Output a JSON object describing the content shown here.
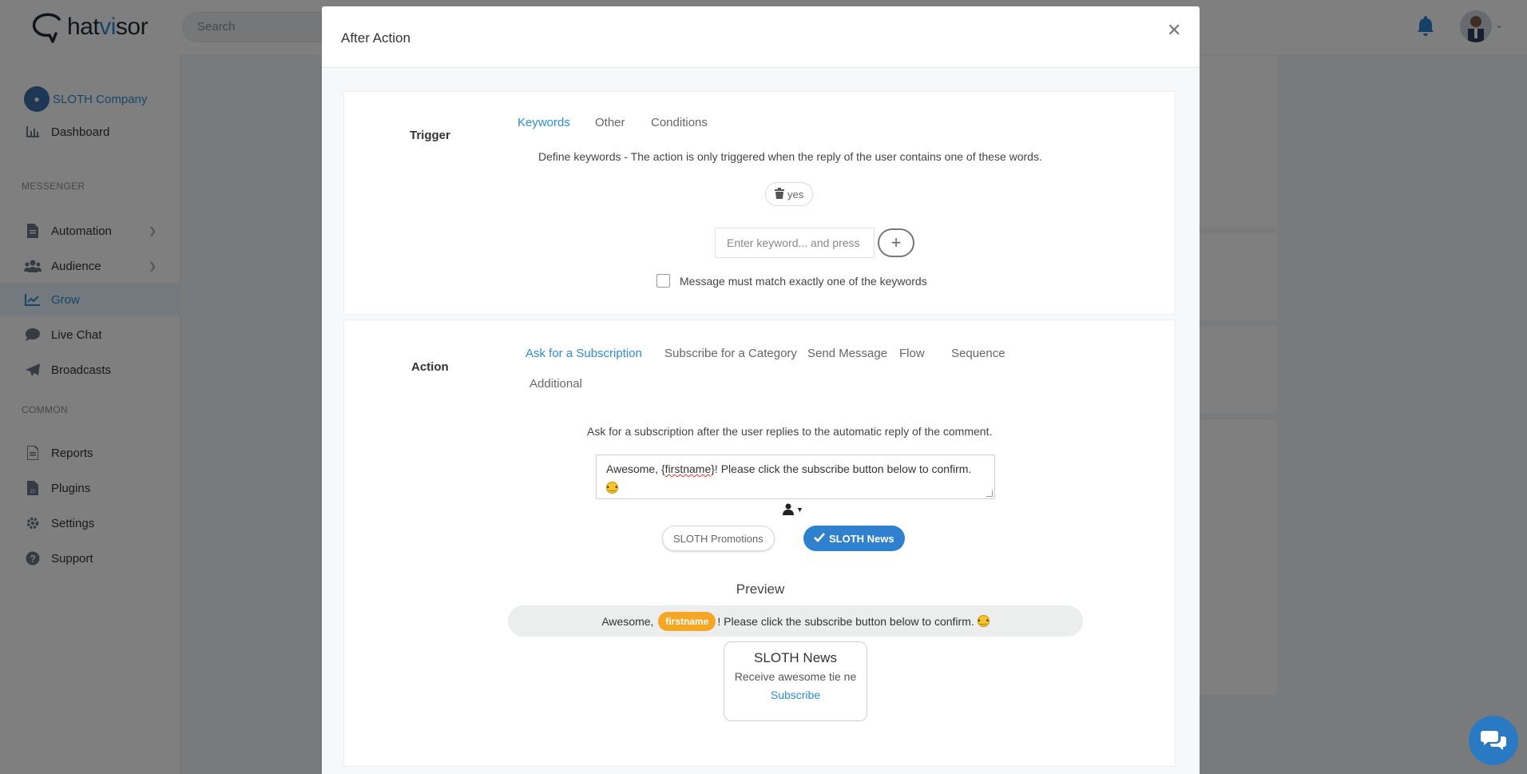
{
  "app": {
    "logo_prefix": "hat",
    "logo_accent": "vi",
    "logo_suffix": "sor",
    "search_placeholder": "Search",
    "accent_color": "#2d8bd6"
  },
  "sidebar": {
    "company": "SLOTH Company",
    "items": [
      {
        "label": "Dashboard",
        "icon": "chart-bar-icon"
      },
      {
        "label": "Automation",
        "icon": "document-icon"
      },
      {
        "label": "Audience",
        "icon": "users-icon"
      },
      {
        "label": "Grow",
        "icon": "line-chart-icon"
      },
      {
        "label": "Live Chat",
        "icon": "chat-bubble-icon"
      },
      {
        "label": "Broadcasts",
        "icon": "paper-plane-icon"
      },
      {
        "label": "Reports",
        "icon": "file-icon"
      },
      {
        "label": "Plugins",
        "icon": "js-file-icon"
      },
      {
        "label": "Settings",
        "icon": "gear-icon"
      },
      {
        "label": "Support",
        "icon": "question-circle-icon"
      }
    ],
    "sections": [
      "MESSENGER",
      "COMMON"
    ],
    "active": "Grow"
  },
  "modal": {
    "title": "After Action",
    "trigger": {
      "label": "Trigger",
      "tabs": [
        "Keywords",
        "Other",
        "Conditions"
      ],
      "active_tab": "Keywords",
      "description": "Define keywords - The action is only triggered when the reply of the user contains one of these words.",
      "keywords": [
        "yes"
      ],
      "keyword_placeholder": "Enter keyword... and press",
      "exact_match_label": "Message must match exactly one of the keywords"
    },
    "action": {
      "label": "Action",
      "tabs": [
        "Ask for a Subscription",
        "Subscribe for a Category",
        "Send Message",
        "Flow",
        "Sequence",
        "Additional"
      ],
      "active_tab": "Ask for a Subscription",
      "description": "Ask for a subscription after the user replies to the automatic reply of the comment.",
      "message_pre": "Awesome, {",
      "message_var": "firstname",
      "message_post": "}! Please click the subscribe button below to confirm.",
      "categories": [
        {
          "label": "SLOTH Promotions",
          "selected": false
        },
        {
          "label": "SLOTH News",
          "selected": true
        }
      ],
      "preview_title": "Preview",
      "preview_pre": "Awesome, ",
      "preview_var": "firstname",
      "preview_post": "! Please click the subscribe button below to confirm.",
      "card_title": "SLOTH News",
      "card_subtitle": "Receive awesome tie ne",
      "card_button": "Subscribe"
    }
  }
}
